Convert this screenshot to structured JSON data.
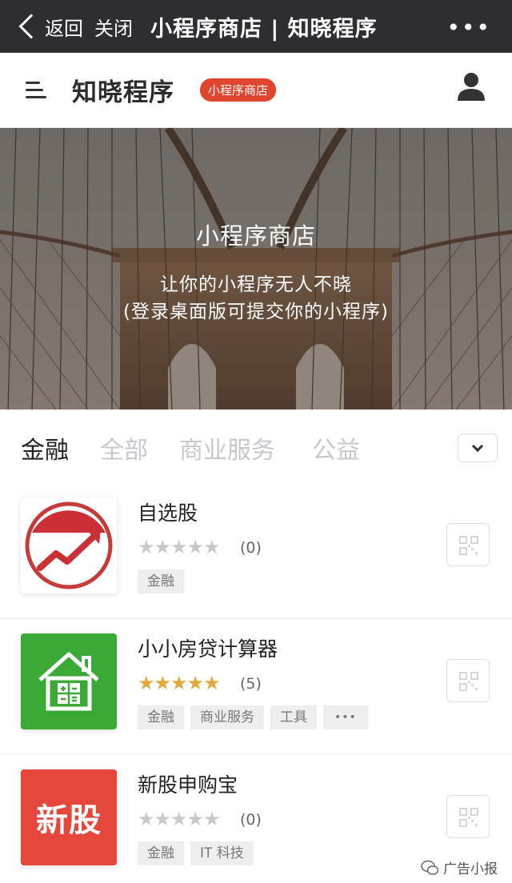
{
  "wechat_bar": {
    "back_label": "返回",
    "close_label": "关闭",
    "title": "小程序商店 | 知晓程序",
    "more_label": "•••"
  },
  "site_header": {
    "brand": "知晓程序",
    "badge": "小程序商店"
  },
  "hero": {
    "title": "小程序商店",
    "subtitle_line1": "让你的小程序无人不晓",
    "subtitle_line2": "(登录桌面版可提交你的小程序)"
  },
  "tabs": [
    {
      "label": "金融",
      "active": true
    },
    {
      "label": "全部",
      "active": false
    },
    {
      "label": "商业服务",
      "active": false
    },
    {
      "label": "公益",
      "active": false
    }
  ],
  "apps": [
    {
      "name": "自选股",
      "rating": 0,
      "rating_count": "(0)",
      "tags": [
        "金融"
      ],
      "icon": "stock-chart-icon"
    },
    {
      "name": "小小房贷计算器",
      "rating": 5,
      "rating_count": "(5)",
      "tags": [
        "金融",
        "商业服务",
        "工具",
        "•••"
      ],
      "icon": "house-calculator-icon"
    },
    {
      "name": "新股申购宝",
      "rating": 0,
      "rating_count": "(0)",
      "tags": [
        "金融",
        "IT 科技"
      ],
      "icon": "new-stock-icon",
      "icon_text": "新股"
    }
  ],
  "watermark": "广告小报",
  "colors": {
    "wechat_bar": "#2e2e32",
    "badge": "#e0462f",
    "star_on": "#e2a93c",
    "star_off": "#c9c9cc",
    "green_icon": "#3aa935",
    "red_icon": "#e5473b"
  }
}
